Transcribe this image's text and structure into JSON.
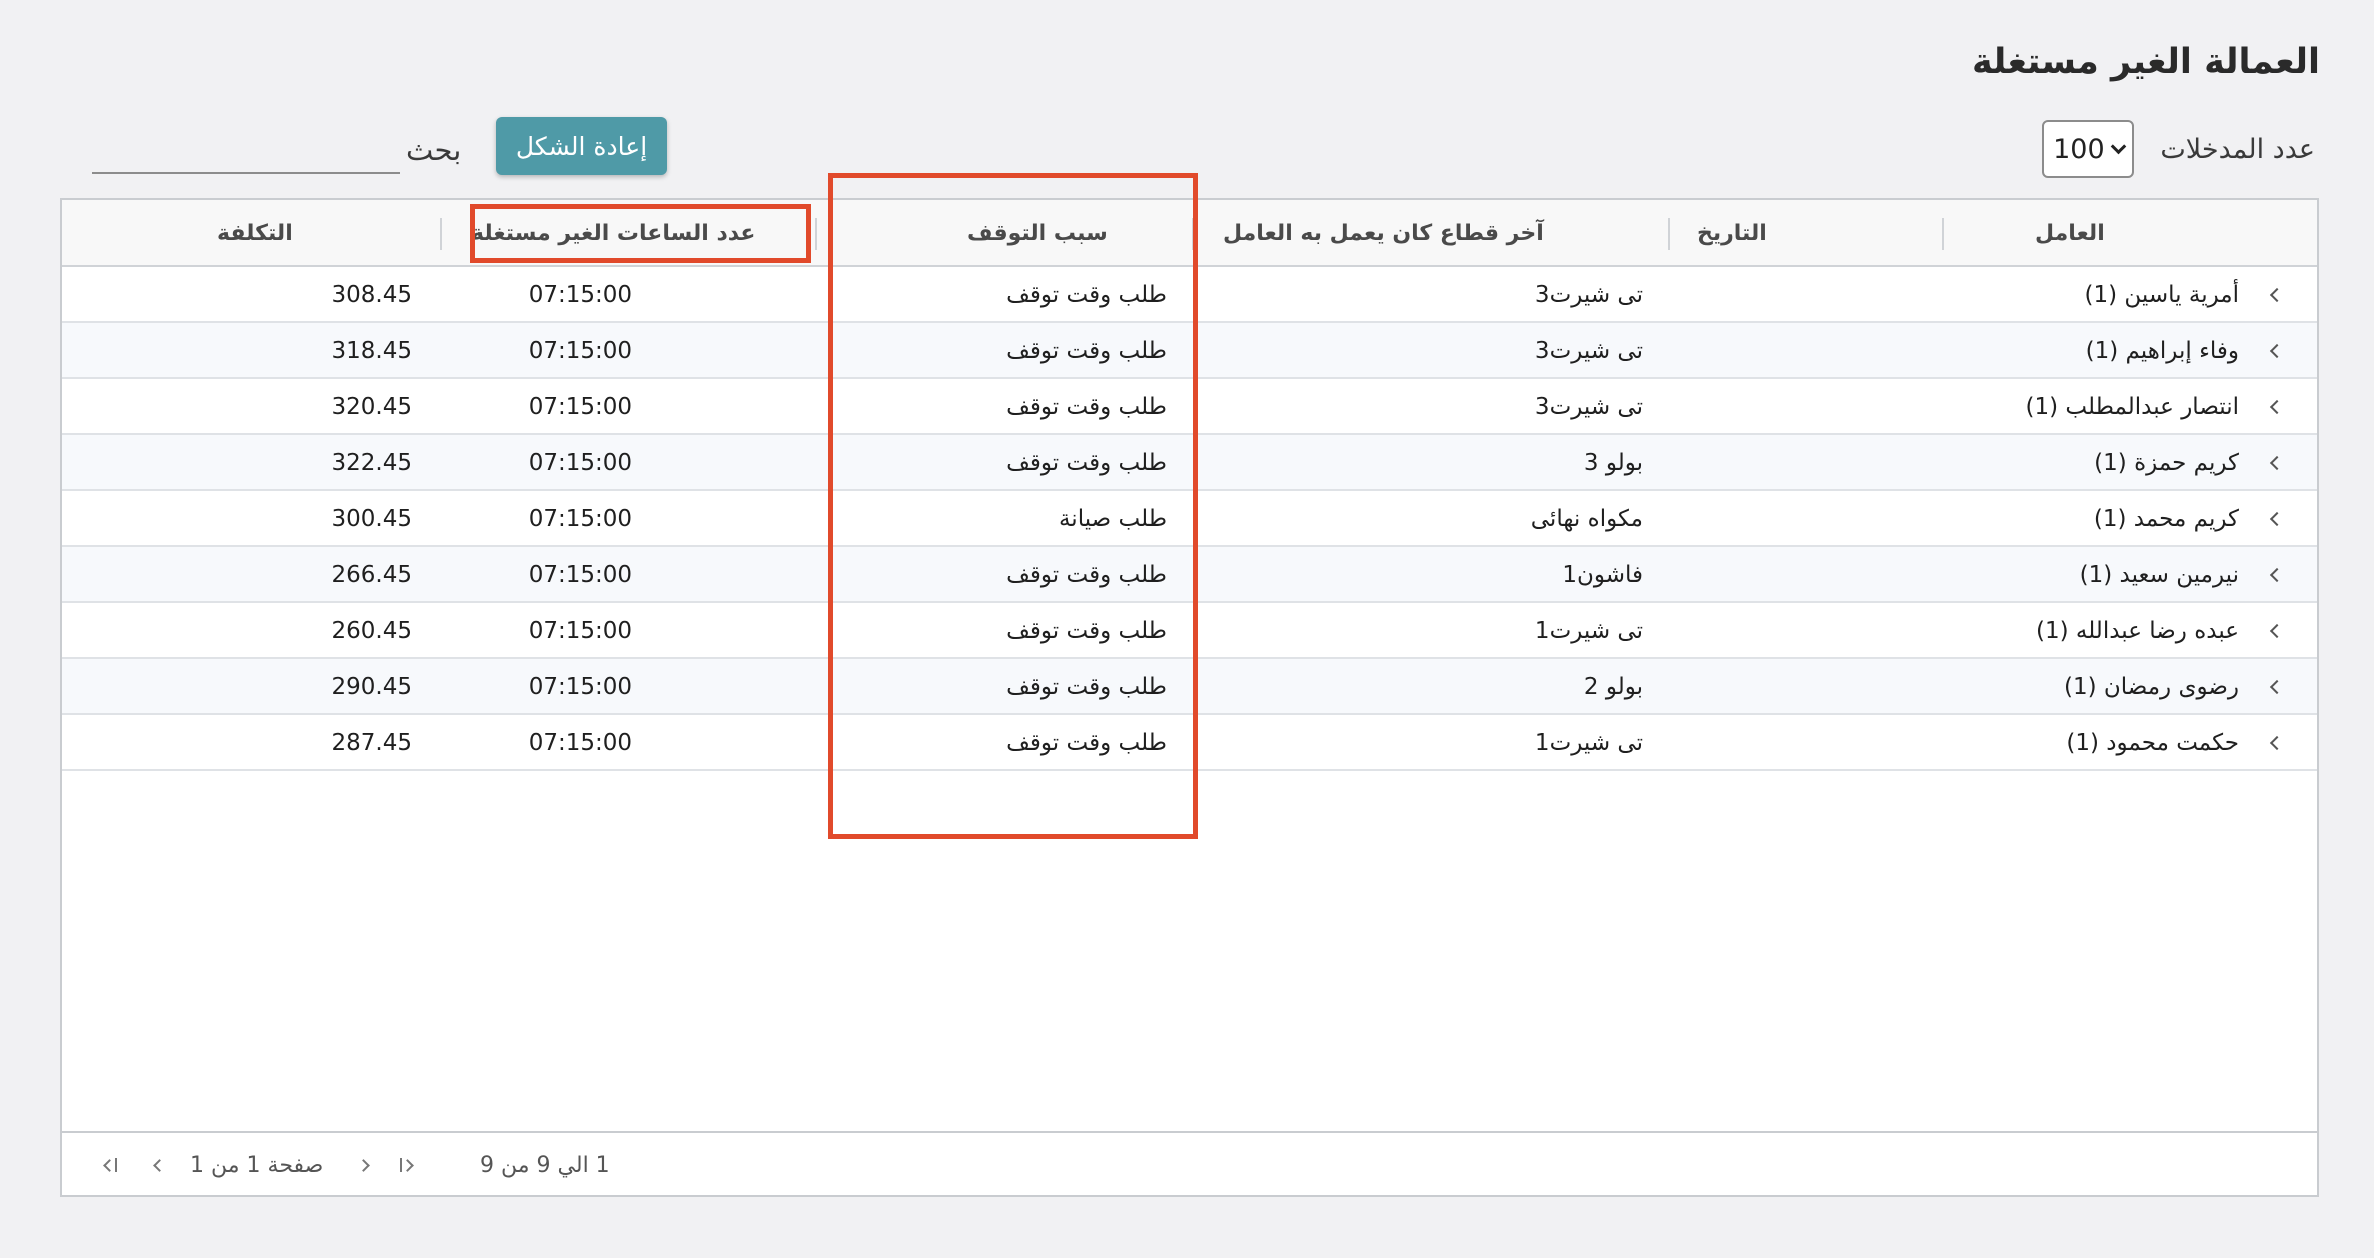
{
  "page": {
    "title": "العمالة الغير مستغلة"
  },
  "toolbar": {
    "entries_label": "عدد المدخلات",
    "entries_value": "100",
    "reset_label": "إعادة الشكل",
    "search_label": "بحث",
    "search_value": ""
  },
  "table": {
    "headers": [
      "العامل",
      "التاريخ",
      "آخر قطاع كان يعمل به العامل",
      "سبب التوقف",
      "عدد الساعات الغير مستغلة",
      "التكلفة"
    ],
    "rows": [
      {
        "worker": "أمرية ياسين (1)",
        "date": "",
        "sector": "تى شيرت3",
        "reason": "طلب وقت توقف",
        "hours": "07:15:00",
        "cost": "308.45"
      },
      {
        "worker": "وفاء إبراهيم (1)",
        "date": "",
        "sector": "تى شيرت3",
        "reason": "طلب وقت توقف",
        "hours": "07:15:00",
        "cost": "318.45"
      },
      {
        "worker": "انتصار عبدالمطلب (1)",
        "date": "",
        "sector": "تى شيرت3",
        "reason": "طلب وقت توقف",
        "hours": "07:15:00",
        "cost": "320.45"
      },
      {
        "worker": "كريم حمزة (1)",
        "date": "",
        "sector": "بولو 3",
        "reason": "طلب وقت توقف",
        "hours": "07:15:00",
        "cost": "322.45"
      },
      {
        "worker": "كريم محمد (1)",
        "date": "",
        "sector": "مكواه نهائى",
        "reason": "طلب صيانة",
        "hours": "07:15:00",
        "cost": "300.45"
      },
      {
        "worker": "نيرمين سعيد (1)",
        "date": "",
        "sector": "فاشون1",
        "reason": "طلب وقت توقف",
        "hours": "07:15:00",
        "cost": "266.45"
      },
      {
        "worker": "عبده رضا عبدالله (1)",
        "date": "",
        "sector": "تى شيرت1",
        "reason": "طلب وقت توقف",
        "hours": "07:15:00",
        "cost": "260.45"
      },
      {
        "worker": "رضوى رمضان (1)",
        "date": "",
        "sector": "بولو 2",
        "reason": "طلب وقت توقف",
        "hours": "07:15:00",
        "cost": "290.45"
      },
      {
        "worker": "حكمت محمود (1)",
        "date": "",
        "sector": "تى شيرت1",
        "reason": "طلب وقت توقف",
        "hours": "07:15:00",
        "cost": "287.45"
      }
    ]
  },
  "pagination": {
    "range_text": "1 الي 9 من 9",
    "page_text": "صفحة 1 من 1"
  },
  "colors": {
    "accent": "#4f9aa7",
    "highlight": "#e14a2b"
  },
  "icons": [
    "chevron-down-icon",
    "chevron-left-icon",
    "first-page-icon",
    "previous-page-icon",
    "next-page-icon",
    "last-page-icon"
  ]
}
